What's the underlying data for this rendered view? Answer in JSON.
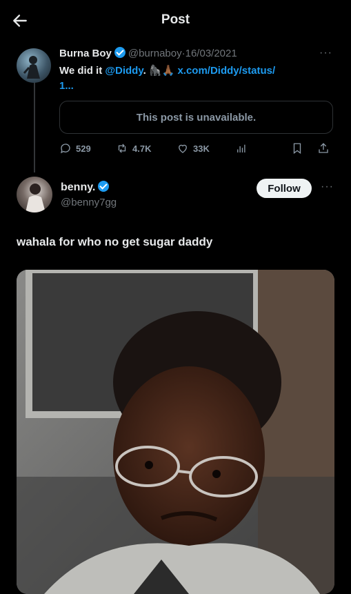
{
  "header": {
    "title": "Post",
    "back_icon": "arrow-left-icon"
  },
  "quoted_tweet": {
    "name": "Burna Boy",
    "handle": "@burnaboy",
    "separator": "·",
    "date": "16/03/2021",
    "text_prefix": "We did it ",
    "mention": "@Diddy",
    "text_suffix": ". ",
    "emojis": "🦍🙏🏾",
    "link_line1": "x.com/Diddy/status/",
    "link_line2": "1...",
    "unavailable": "This post is unavailable.",
    "stats": {
      "replies": "529",
      "reposts": "4.7K",
      "likes": "33K"
    },
    "more": "···"
  },
  "main_tweet": {
    "name": "benny.",
    "handle": "@benny7gg",
    "follow_label": "Follow",
    "more": "···",
    "text": "wahala for who no get sugar daddy"
  },
  "colors": {
    "accent": "#1d9bf0",
    "background": "#000000",
    "muted": "#71767b"
  }
}
